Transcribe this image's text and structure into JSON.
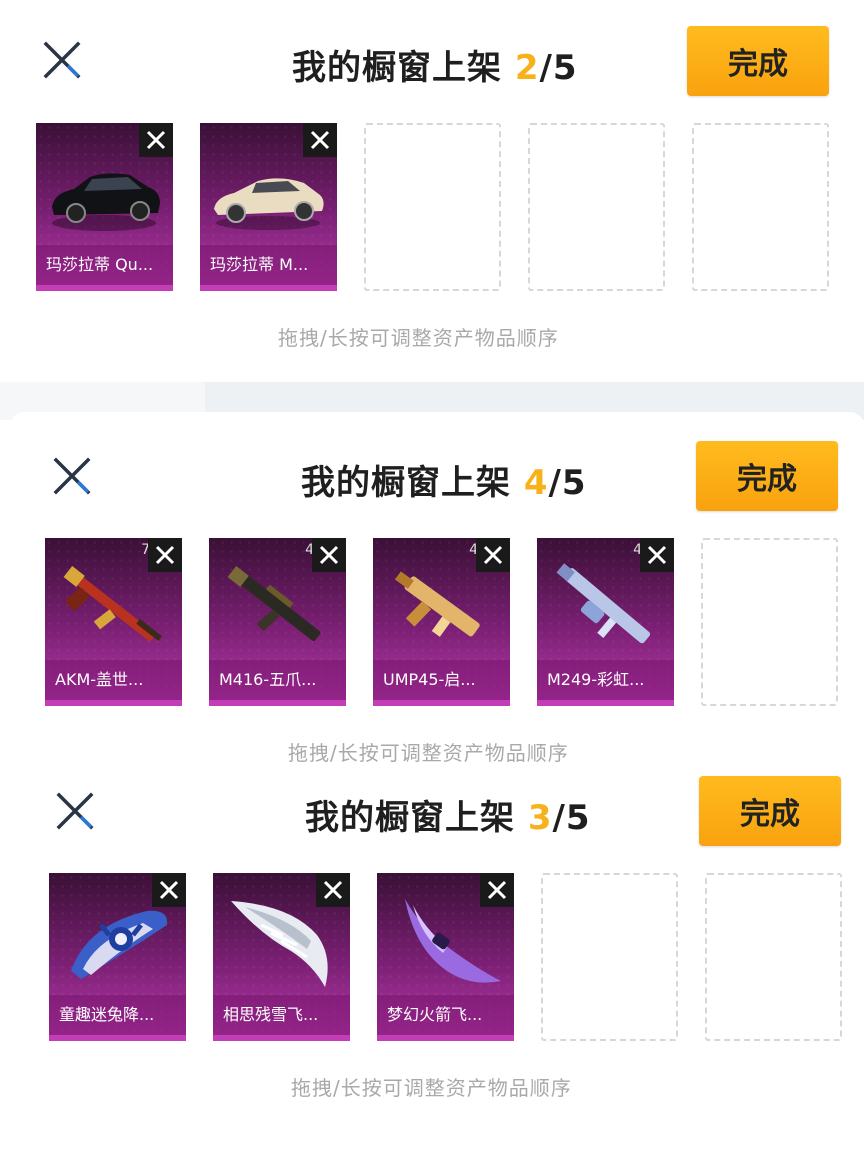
{
  "panels": [
    {
      "title": "我的橱窗上架",
      "count": "2",
      "total": "/5",
      "done_label": "完成",
      "hint": "拖拽/长按可调整资产物品顺序",
      "items": [
        {
          "name": "玛莎拉蒂 Qu...",
          "corner": "",
          "icon": "black-car-icon"
        },
        {
          "name": "玛莎拉蒂 M...",
          "corner": "",
          "icon": "beige-sports-car-icon"
        }
      ],
      "empty_slots": 3
    },
    {
      "title": "我的橱窗上架",
      "count": "4",
      "total": "/5",
      "done_label": "完成",
      "hint": "拖拽/长按可调整资产物品顺序",
      "items": [
        {
          "name": "AKM-盖世...",
          "corner": "7",
          "icon": "akm-rifle-icon"
        },
        {
          "name": "M416-五爪...",
          "corner": "4",
          "icon": "m416-rifle-icon"
        },
        {
          "name": "UMP45-启...",
          "corner": "4",
          "icon": "ump45-smg-icon"
        },
        {
          "name": "M249-彩虹...",
          "corner": "4",
          "icon": "m249-lmg-icon"
        }
      ],
      "empty_slots": 1
    },
    {
      "title": "我的橱窗上架",
      "count": "3",
      "total": "/5",
      "done_label": "完成",
      "hint": "拖拽/长按可调整资产物品顺序",
      "items": [
        {
          "name": "童趣迷兔降...",
          "corner": "",
          "icon": "bunny-glider-icon"
        },
        {
          "name": "相思残雪飞...",
          "corner": "",
          "icon": "snow-wing-glider-icon"
        },
        {
          "name": "梦幻火箭飞...",
          "corner": "",
          "icon": "rocket-glider-icon"
        }
      ],
      "empty_slots": 2
    }
  ],
  "colors": {
    "accent": "#f7b21b",
    "button": "#ffb31a",
    "card_purple": "#7a1f73",
    "hint_gray": "#a9a9a9"
  }
}
